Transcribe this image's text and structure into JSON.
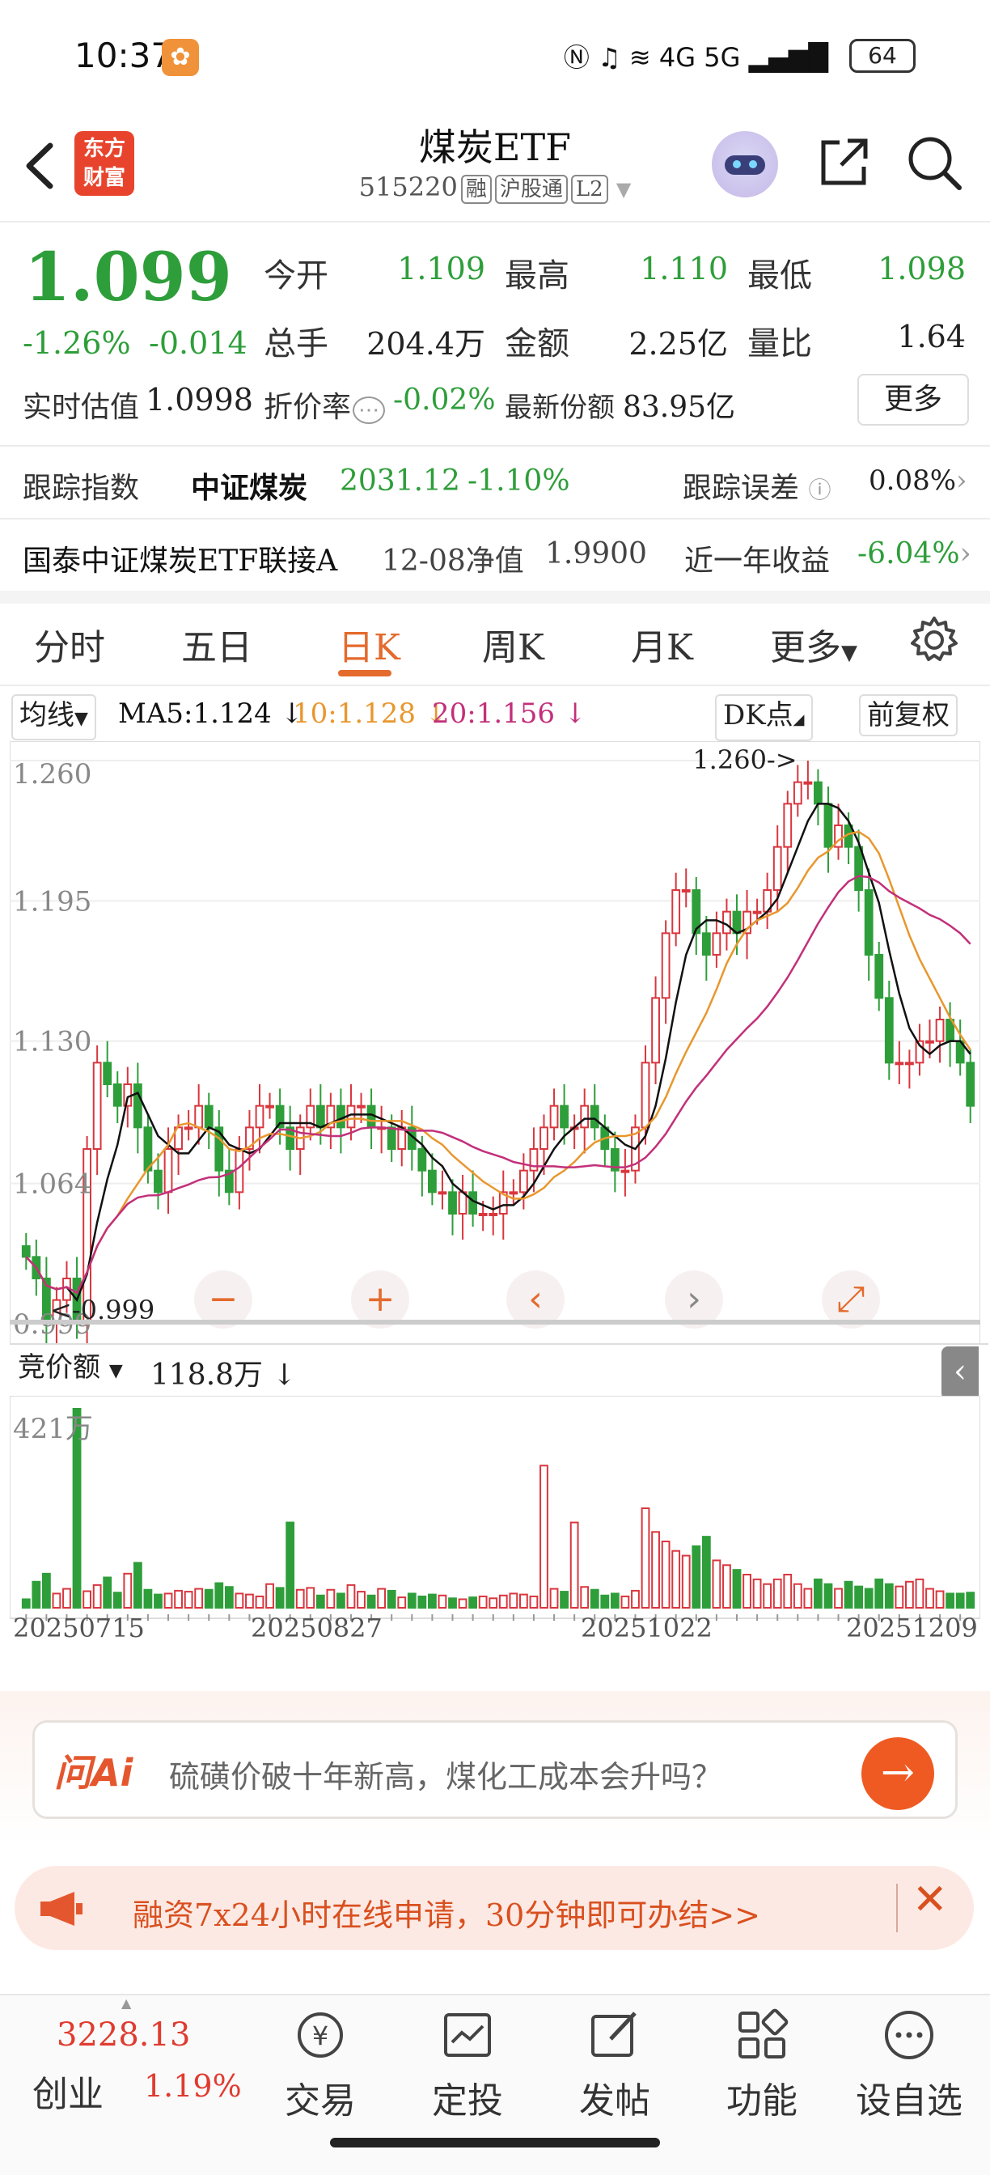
{
  "status": {
    "time": "10:37",
    "battery": "64",
    "network": "4G  5G"
  },
  "header": {
    "logo_line1": "东方",
    "logo_line2": "财富",
    "title": "煤炭ETF",
    "code": "515220",
    "tags": [
      "融",
      "沪股通",
      "L2"
    ]
  },
  "quote": {
    "price": "1.099",
    "change_pct": "-1.26%",
    "change_abs": "-0.014",
    "open_label": "今开",
    "open": "1.109",
    "high_label": "最高",
    "high": "1.110",
    "low_label": "最低",
    "low": "1.098",
    "volume_label": "总手",
    "volume": "204.4万",
    "amount_label": "金额",
    "amount": "2.25亿",
    "ratio_label": "量比",
    "ratio": "1.64",
    "iopv_label": "实时估值",
    "iopv": "1.0998",
    "discount_label": "折价率",
    "discount": "-0.02%",
    "shares_label": "最新份额",
    "shares": "83.95亿",
    "more_label": "更多"
  },
  "tracking": {
    "index_label": "跟踪指数",
    "index_name": "中证煤炭",
    "index_value": "2031.12",
    "index_change": "-1.10%",
    "error_label": "跟踪误差",
    "error_value": "0.08%"
  },
  "link_fund": {
    "name": "国泰中证煤炭ETF联接A",
    "nav_label": "12-08净值",
    "nav": "1.9900",
    "return_label": "近一年收益",
    "return_value": "-6.04%"
  },
  "tabs": [
    "分时",
    "五日",
    "日K",
    "周K",
    "月K",
    "更多"
  ],
  "active_tab": "日K",
  "ma_bar": {
    "ma_dropdown": "均线",
    "ma5": "MA5:1.124 ↓",
    "ma10": "10:1.128 ↓",
    "ma20": "20:1.156 ↓",
    "dk_button": "DK点",
    "adjust_button": "前复权"
  },
  "volume_bar": {
    "dropdown": "竞价额",
    "value": "118.8万 ↓",
    "max_label": "421万"
  },
  "colors": {
    "up": "#d9363e",
    "down": "#2e9e3a",
    "ma5": "#111111",
    "ma10": "#e8972e",
    "ma20": "#c2307a",
    "accent": "#e46a2d"
  },
  "chart_data": {
    "type": "candlestick",
    "y_ticks": [
      "1.260",
      "1.195",
      "1.130",
      "1.064",
      "0.999"
    ],
    "ylim": [
      0.999,
      1.26
    ],
    "high_annotation": "1.260->",
    "low_annotation": "<-0.999",
    "x_ticks": [
      "20250715",
      "20250827",
      "20251022",
      "20251209"
    ],
    "volume_max": "421万",
    "ma5_last": 1.124,
    "ma10_last": 1.128,
    "ma20_last": 1.156,
    "closes": [
      1.03,
      1.02,
      1.0,
      1.01,
      1.02,
      1.0,
      1.08,
      1.12,
      1.11,
      1.1,
      1.11,
      1.09,
      1.07,
      1.06,
      1.08,
      1.09,
      1.09,
      1.1,
      1.09,
      1.07,
      1.06,
      1.08,
      1.09,
      1.1,
      1.1,
      1.09,
      1.08,
      1.09,
      1.1,
      1.09,
      1.1,
      1.09,
      1.1,
      1.1,
      1.09,
      1.09,
      1.08,
      1.09,
      1.08,
      1.07,
      1.06,
      1.06,
      1.05,
      1.06,
      1.05,
      1.05,
      1.05,
      1.06,
      1.06,
      1.07,
      1.08,
      1.09,
      1.1,
      1.09,
      1.09,
      1.1,
      1.09,
      1.08,
      1.07,
      1.07,
      1.09,
      1.12,
      1.15,
      1.18,
      1.2,
      1.2,
      1.18,
      1.17,
      1.18,
      1.19,
      1.18,
      1.19,
      1.19,
      1.2,
      1.22,
      1.24,
      1.25,
      1.25,
      1.24,
      1.22,
      1.23,
      1.22,
      1.2,
      1.17,
      1.15,
      1.12,
      1.12,
      1.12,
      1.13,
      1.13,
      1.14,
      1.13,
      1.12,
      1.1
    ],
    "volumes": [
      18,
      55,
      72,
      30,
      40,
      420,
      35,
      48,
      64,
      32,
      72,
      95,
      38,
      28,
      30,
      36,
      34,
      40,
      38,
      52,
      44,
      30,
      28,
      24,
      50,
      42,
      180,
      38,
      42,
      26,
      38,
      30,
      48,
      34,
      26,
      40,
      36,
      22,
      30,
      24,
      28,
      26,
      20,
      18,
      22,
      24,
      20,
      26,
      30,
      28,
      24,
      300,
      40,
      34,
      180,
      44,
      38,
      26,
      30,
      24,
      36,
      210,
      160,
      140,
      120,
      110,
      130,
      150,
      100,
      90,
      80,
      70,
      60,
      50,
      60,
      70,
      50,
      40,
      60,
      50,
      40,
      55,
      45,
      40,
      60,
      50,
      45,
      55,
      60,
      40,
      35,
      30,
      30,
      32
    ]
  },
  "ai": {
    "label": "问Ai",
    "question": "硫磺价破十年新高，煤化工成本会升吗？"
  },
  "banner": {
    "text": "融资7x24小时在线申请，30分钟即可办结>>"
  },
  "bottom_nav": {
    "index_name": "创业",
    "index_value": "3228.13",
    "index_change": "1.19%",
    "items": [
      "交易",
      "定投",
      "发帖",
      "功能",
      "设自选"
    ]
  }
}
